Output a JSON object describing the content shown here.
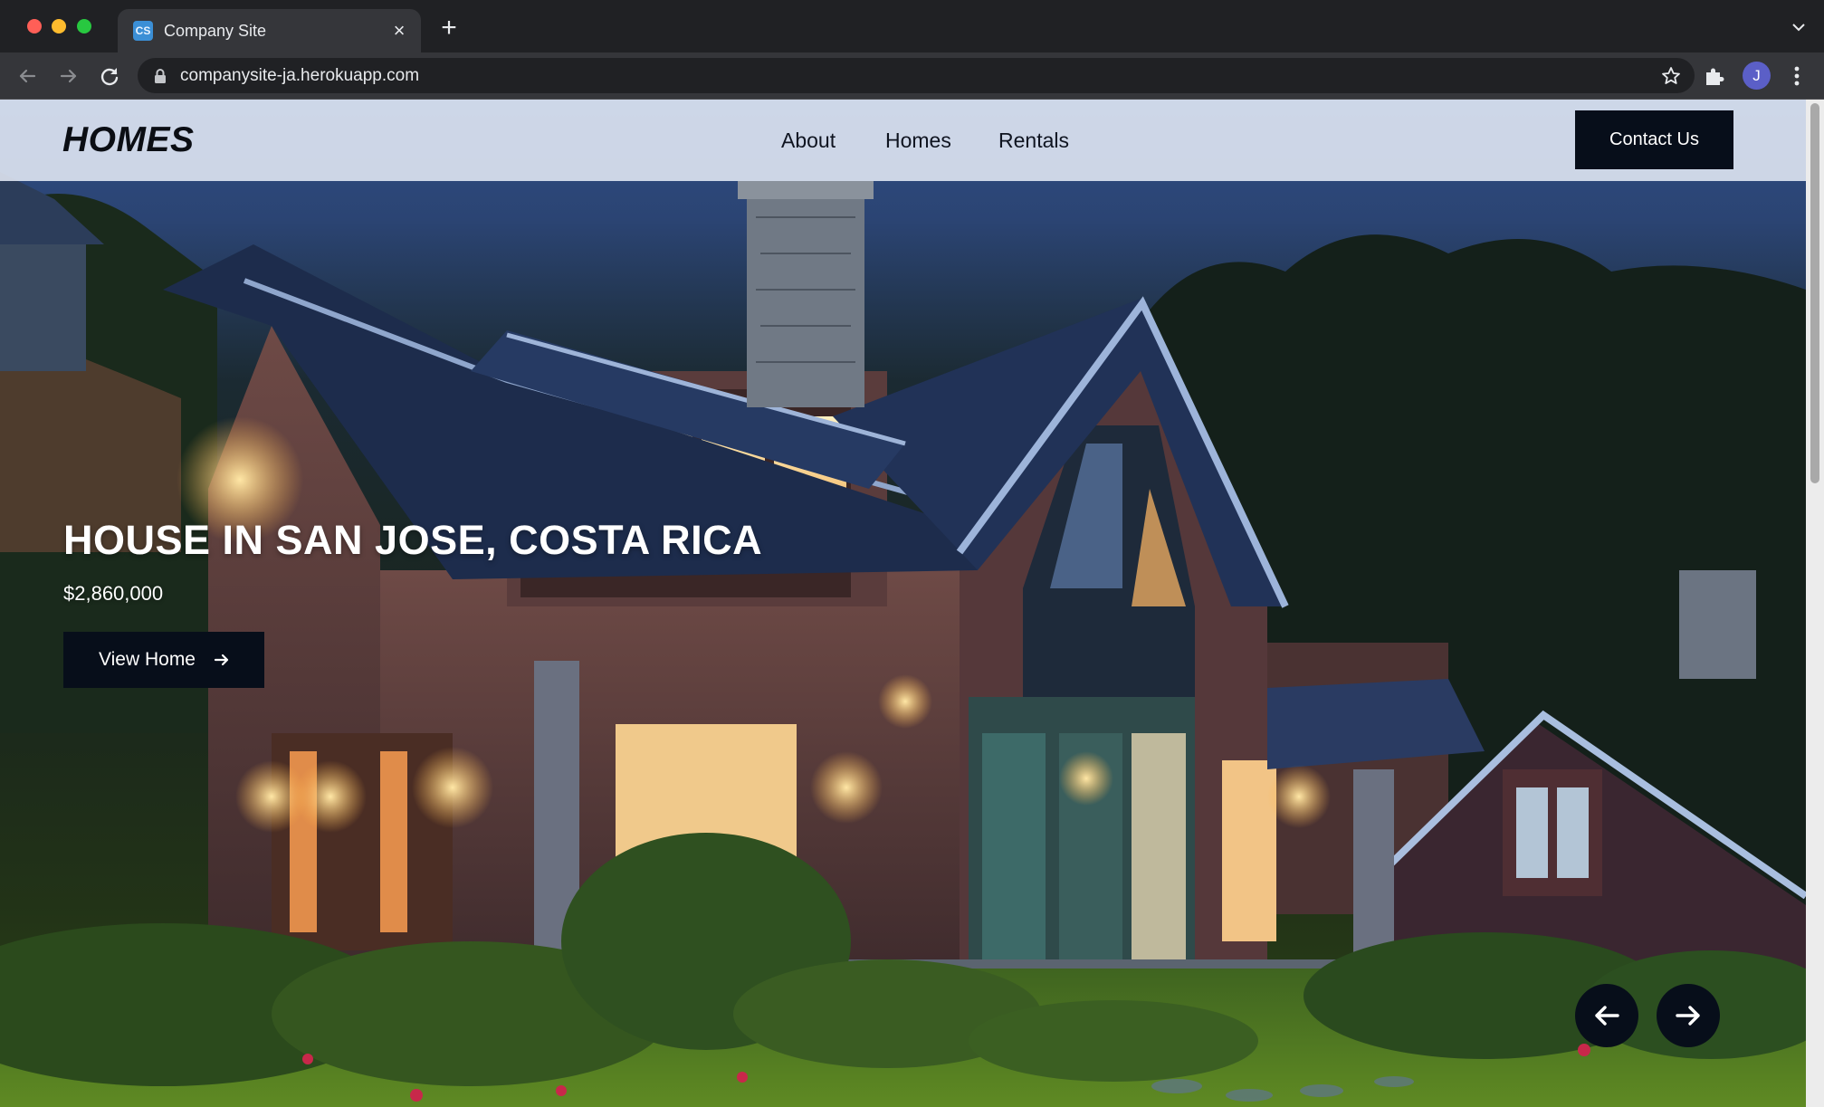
{
  "browser": {
    "tab_title": "Company Site",
    "tab_favicon_text": "CS",
    "url": "companysite-ja.herokuapp.com",
    "profile_initial": "J"
  },
  "site": {
    "logo": "HOMES",
    "nav": [
      "About",
      "Homes",
      "Rentals"
    ],
    "contact_label": "Contact Us"
  },
  "hero": {
    "title": "HOUSE IN SAN JOSE, COSTA RICA",
    "price": "$2,860,000",
    "cta_label": "View Home",
    "cta_icon": "arrow-right-icon",
    "prev_icon": "arrow-left-icon",
    "next_icon": "arrow-right-icon"
  },
  "colors": {
    "header_bg": "#e8eef8",
    "button_dark": "#070e1a",
    "text_dark": "#0b0e14",
    "hero_text": "#ffffff"
  }
}
